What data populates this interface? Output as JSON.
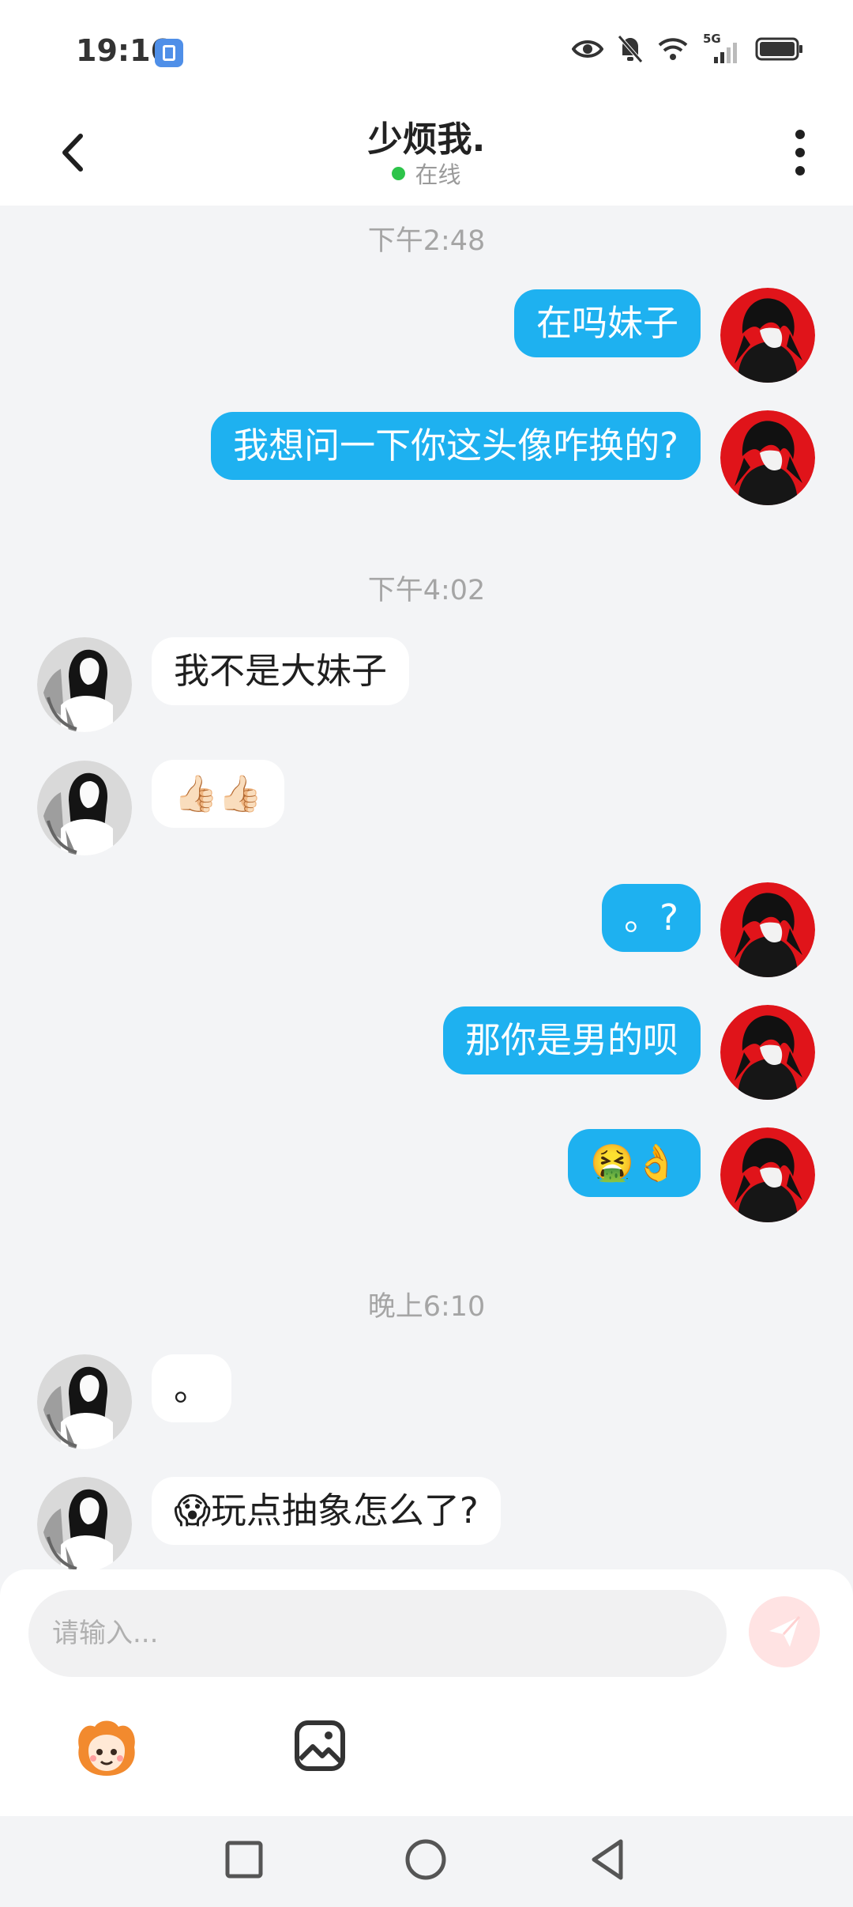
{
  "status_bar": {
    "time": "19:16",
    "icons": [
      "app-notification-icon",
      "eye-icon",
      "bell-muted-icon",
      "wifi-icon",
      "signal-5g-icon",
      "battery-icon"
    ],
    "network_label": "5G"
  },
  "header": {
    "title": "少烦我.",
    "status": "在线",
    "status_color": "#2dc44a"
  },
  "chat": {
    "self_bubble_color": "#1eb1f0",
    "other_bubble_color": "#ffffff",
    "timestamps": [
      "下午2:48",
      "下午4:02",
      "晚上6:10"
    ],
    "messages": [
      {
        "sender": "self",
        "text": "在吗妹子"
      },
      {
        "sender": "self",
        "text": "我想问一下你这头像咋换的?"
      },
      {
        "sender": "other",
        "text": "我不是大妹子"
      },
      {
        "sender": "other",
        "text": "👍🏻👍🏻"
      },
      {
        "sender": "self",
        "text": "。?"
      },
      {
        "sender": "self",
        "text": "那你是男的呗"
      },
      {
        "sender": "self",
        "text": "🤮👌"
      },
      {
        "sender": "other",
        "text": "。"
      },
      {
        "sender": "other",
        "text": "😱玩点抽象怎么了?"
      }
    ]
  },
  "composer": {
    "placeholder": "请输入...",
    "send_icon": "send-icon",
    "tools": [
      "mascot-sticker-icon",
      "image-icon"
    ]
  },
  "nav_bar": {
    "buttons": [
      "recents-button",
      "home-button",
      "back-button"
    ]
  }
}
